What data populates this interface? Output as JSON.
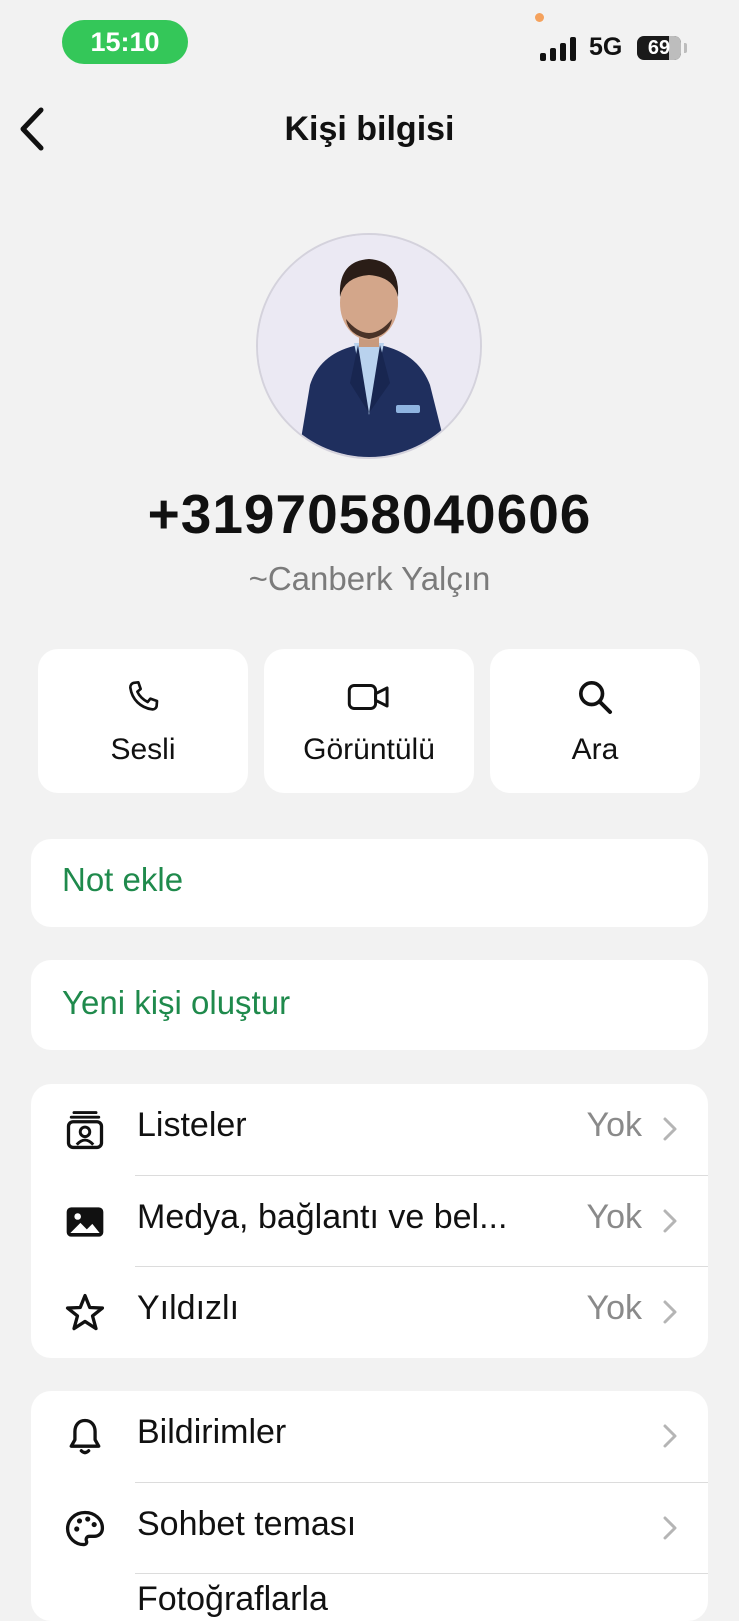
{
  "status": {
    "time": "15:10",
    "network": "5G",
    "battery": "69"
  },
  "nav": {
    "title": "Kişi bilgisi"
  },
  "contact": {
    "phone": "+3197058040606",
    "name": "~Canberk Yalçın"
  },
  "actions": [
    {
      "label": "Sesli",
      "icon": "phone-icon"
    },
    {
      "label": "Görüntülü",
      "icon": "video-icon"
    },
    {
      "label": "Ara",
      "icon": "search-icon"
    }
  ],
  "add_note": "Not ekle",
  "create_contact": "Yeni kişi oluştur",
  "info_rows": [
    {
      "label": "Listeler",
      "value": "Yok",
      "icon": "lists-icon"
    },
    {
      "label": "Medya, bağlantı ve bel...",
      "value": "Yok",
      "icon": "media-icon"
    },
    {
      "label": "Yıldızlı",
      "value": "Yok",
      "icon": "star-icon"
    }
  ],
  "settings_rows": [
    {
      "label": "Bildirimler",
      "icon": "bell-icon"
    },
    {
      "label": "Sohbet teması",
      "icon": "palette-icon"
    },
    {
      "label": "Fotoğraflarla",
      "icon": "photos-icon"
    }
  ],
  "colors": {
    "accent_green": "#1f8a4c",
    "status_green": "#34c759",
    "background": "#f2f2f2"
  }
}
